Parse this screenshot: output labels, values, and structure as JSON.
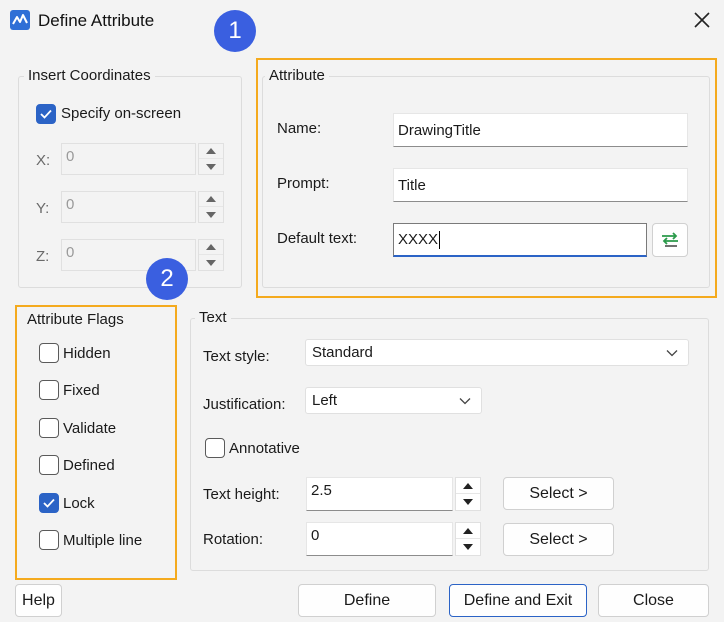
{
  "window": {
    "title": "Define Attribute",
    "close_icon": "close-icon",
    "app_icon": "app-icon"
  },
  "callouts": [
    "1",
    "2"
  ],
  "insert_coordinates": {
    "legend": "Insert Coordinates",
    "specify_on_screen": {
      "label": "Specify on-screen",
      "checked": true
    },
    "x": {
      "label": "X:",
      "value": "0"
    },
    "y": {
      "label": "Y:",
      "value": "0"
    },
    "z": {
      "label": "Z:",
      "value": "0"
    }
  },
  "attribute": {
    "legend": "Attribute",
    "name": {
      "label": "Name:",
      "value": "DrawingTitle"
    },
    "prompt": {
      "label": "Prompt:",
      "value": "Title"
    },
    "default_text": {
      "label": "Default text:",
      "value": "XXXX"
    },
    "insert_field_icon": "insert-field-icon"
  },
  "attribute_flags": {
    "legend": "Attribute Flags",
    "items": [
      {
        "label": "Hidden",
        "checked": false
      },
      {
        "label": "Fixed",
        "checked": false
      },
      {
        "label": "Validate",
        "checked": false
      },
      {
        "label": "Defined",
        "checked": false
      },
      {
        "label": "Lock",
        "checked": true
      },
      {
        "label": "Multiple line",
        "checked": false
      }
    ]
  },
  "text": {
    "legend": "Text",
    "text_style": {
      "label": "Text style:",
      "value": "Standard"
    },
    "justification": {
      "label": "Justification:",
      "value": "Left"
    },
    "annotative": {
      "label": "Annotative",
      "checked": false
    },
    "text_height": {
      "label": "Text height:",
      "value": "2.5",
      "select_label": "Select  >"
    },
    "rotation": {
      "label": "Rotation:",
      "value": "0",
      "select_label": "Select  >"
    }
  },
  "buttons": {
    "help": "Help",
    "define": "Define",
    "define_and_exit": "Define and Exit",
    "close": "Close"
  },
  "colors": {
    "accent": "#2b63c6",
    "highlight": "#f4aa1e",
    "callout": "#3a5fe0"
  }
}
